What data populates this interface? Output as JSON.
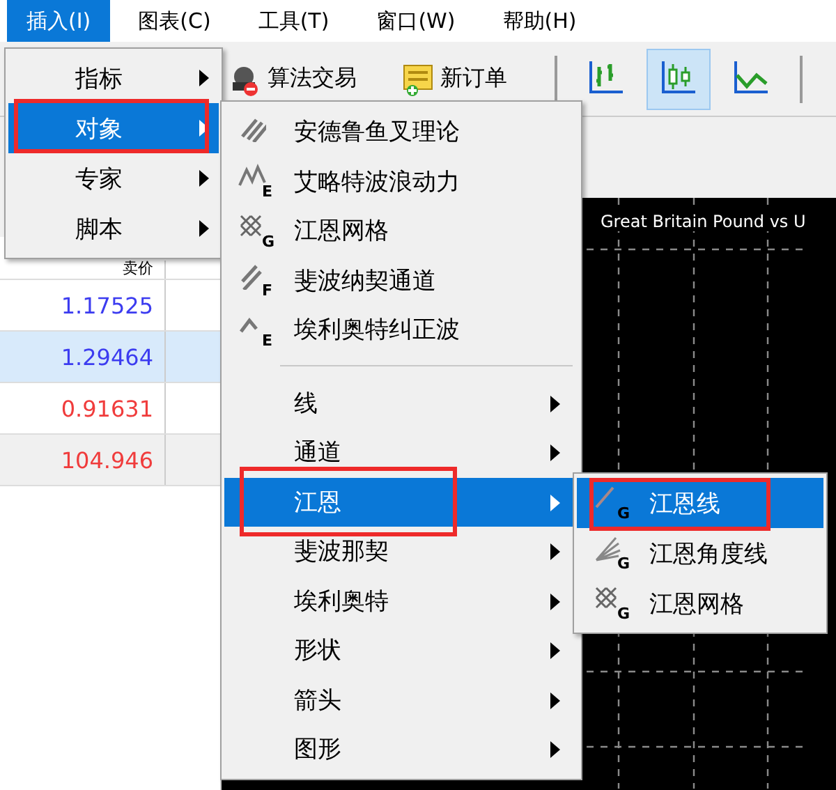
{
  "menu_bar": [
    {
      "label": "插入(I)",
      "selected": true
    },
    {
      "label": "图表(C)",
      "selected": false
    },
    {
      "label": "工具(T)",
      "selected": false
    },
    {
      "label": "窗口(W)",
      "selected": false
    },
    {
      "label": "帮助(H)",
      "selected": false
    }
  ],
  "toolbar": [
    {
      "kind": "command",
      "label": "算法交易",
      "selected": false
    },
    {
      "kind": "command",
      "label": "新订单",
      "selected": false
    },
    {
      "kind": "chart_type",
      "selected": false
    },
    {
      "kind": "chart_type",
      "selected": true
    },
    {
      "kind": "chart_type",
      "selected": false
    }
  ],
  "quotes": {
    "column_header": "卖价",
    "rows": [
      {
        "value": "1.17525",
        "color": "#3c3cf0",
        "selected": false
      },
      {
        "value": "1.29464",
        "color": "#3c3cf0",
        "selected": true
      },
      {
        "value": "0.91631",
        "color": "#f03c3c",
        "selected": false
      },
      {
        "value": "104.946",
        "color": "#f03c3c",
        "selected": false
      }
    ]
  },
  "chart": {
    "title": "Great Britain Pound vs U"
  },
  "menus": [
    {
      "items": [
        {
          "kind": "submenu",
          "label": "指标",
          "selected": false,
          "annotated": false
        },
        {
          "kind": "submenu",
          "label": "对象",
          "selected": true,
          "annotated": true
        },
        {
          "kind": "submenu",
          "label": "专家",
          "selected": false,
          "annotated": false
        },
        {
          "kind": "submenu",
          "label": "脚本",
          "selected": false,
          "annotated": false
        }
      ]
    },
    {
      "items": [
        {
          "kind": "command",
          "label": "安德鲁鱼叉理论",
          "selected": false,
          "annotated": false
        },
        {
          "kind": "command",
          "label": "艾略特波浪动力",
          "icon_letter": "E",
          "selected": false,
          "annotated": false
        },
        {
          "kind": "command",
          "label": "江恩网格",
          "icon_letter": "G",
          "selected": false,
          "annotated": false
        },
        {
          "kind": "command",
          "label": "斐波纳契通道",
          "icon_letter": "F",
          "selected": false,
          "annotated": false
        },
        {
          "kind": "command",
          "label": "埃利奥特纠正波",
          "icon_letter": "E",
          "selected": false,
          "annotated": false
        },
        {
          "kind": "separator"
        },
        {
          "kind": "submenu",
          "label": "线",
          "selected": false,
          "annotated": false
        },
        {
          "kind": "submenu",
          "label": "通道",
          "selected": false,
          "annotated": false
        },
        {
          "kind": "submenu",
          "label": "江恩",
          "selected": true,
          "annotated": true
        },
        {
          "kind": "submenu",
          "label": "斐波那契",
          "selected": false,
          "annotated": false
        },
        {
          "kind": "submenu",
          "label": "埃利奥特",
          "selected": false,
          "annotated": false
        },
        {
          "kind": "submenu",
          "label": "形状",
          "selected": false,
          "annotated": false
        },
        {
          "kind": "submenu",
          "label": "箭头",
          "selected": false,
          "annotated": false
        },
        {
          "kind": "submenu",
          "label": "图形",
          "selected": false,
          "annotated": false
        }
      ]
    },
    {
      "items": [
        {
          "kind": "command",
          "label": "江恩线",
          "icon_letter": "G",
          "selected": true,
          "annotated": true
        },
        {
          "kind": "command",
          "label": "江恩角度线",
          "icon_letter": "G",
          "selected": false,
          "annotated": false
        },
        {
          "kind": "command",
          "label": "江恩网格",
          "icon_letter": "G",
          "selected": false,
          "annotated": false
        }
      ]
    }
  ]
}
